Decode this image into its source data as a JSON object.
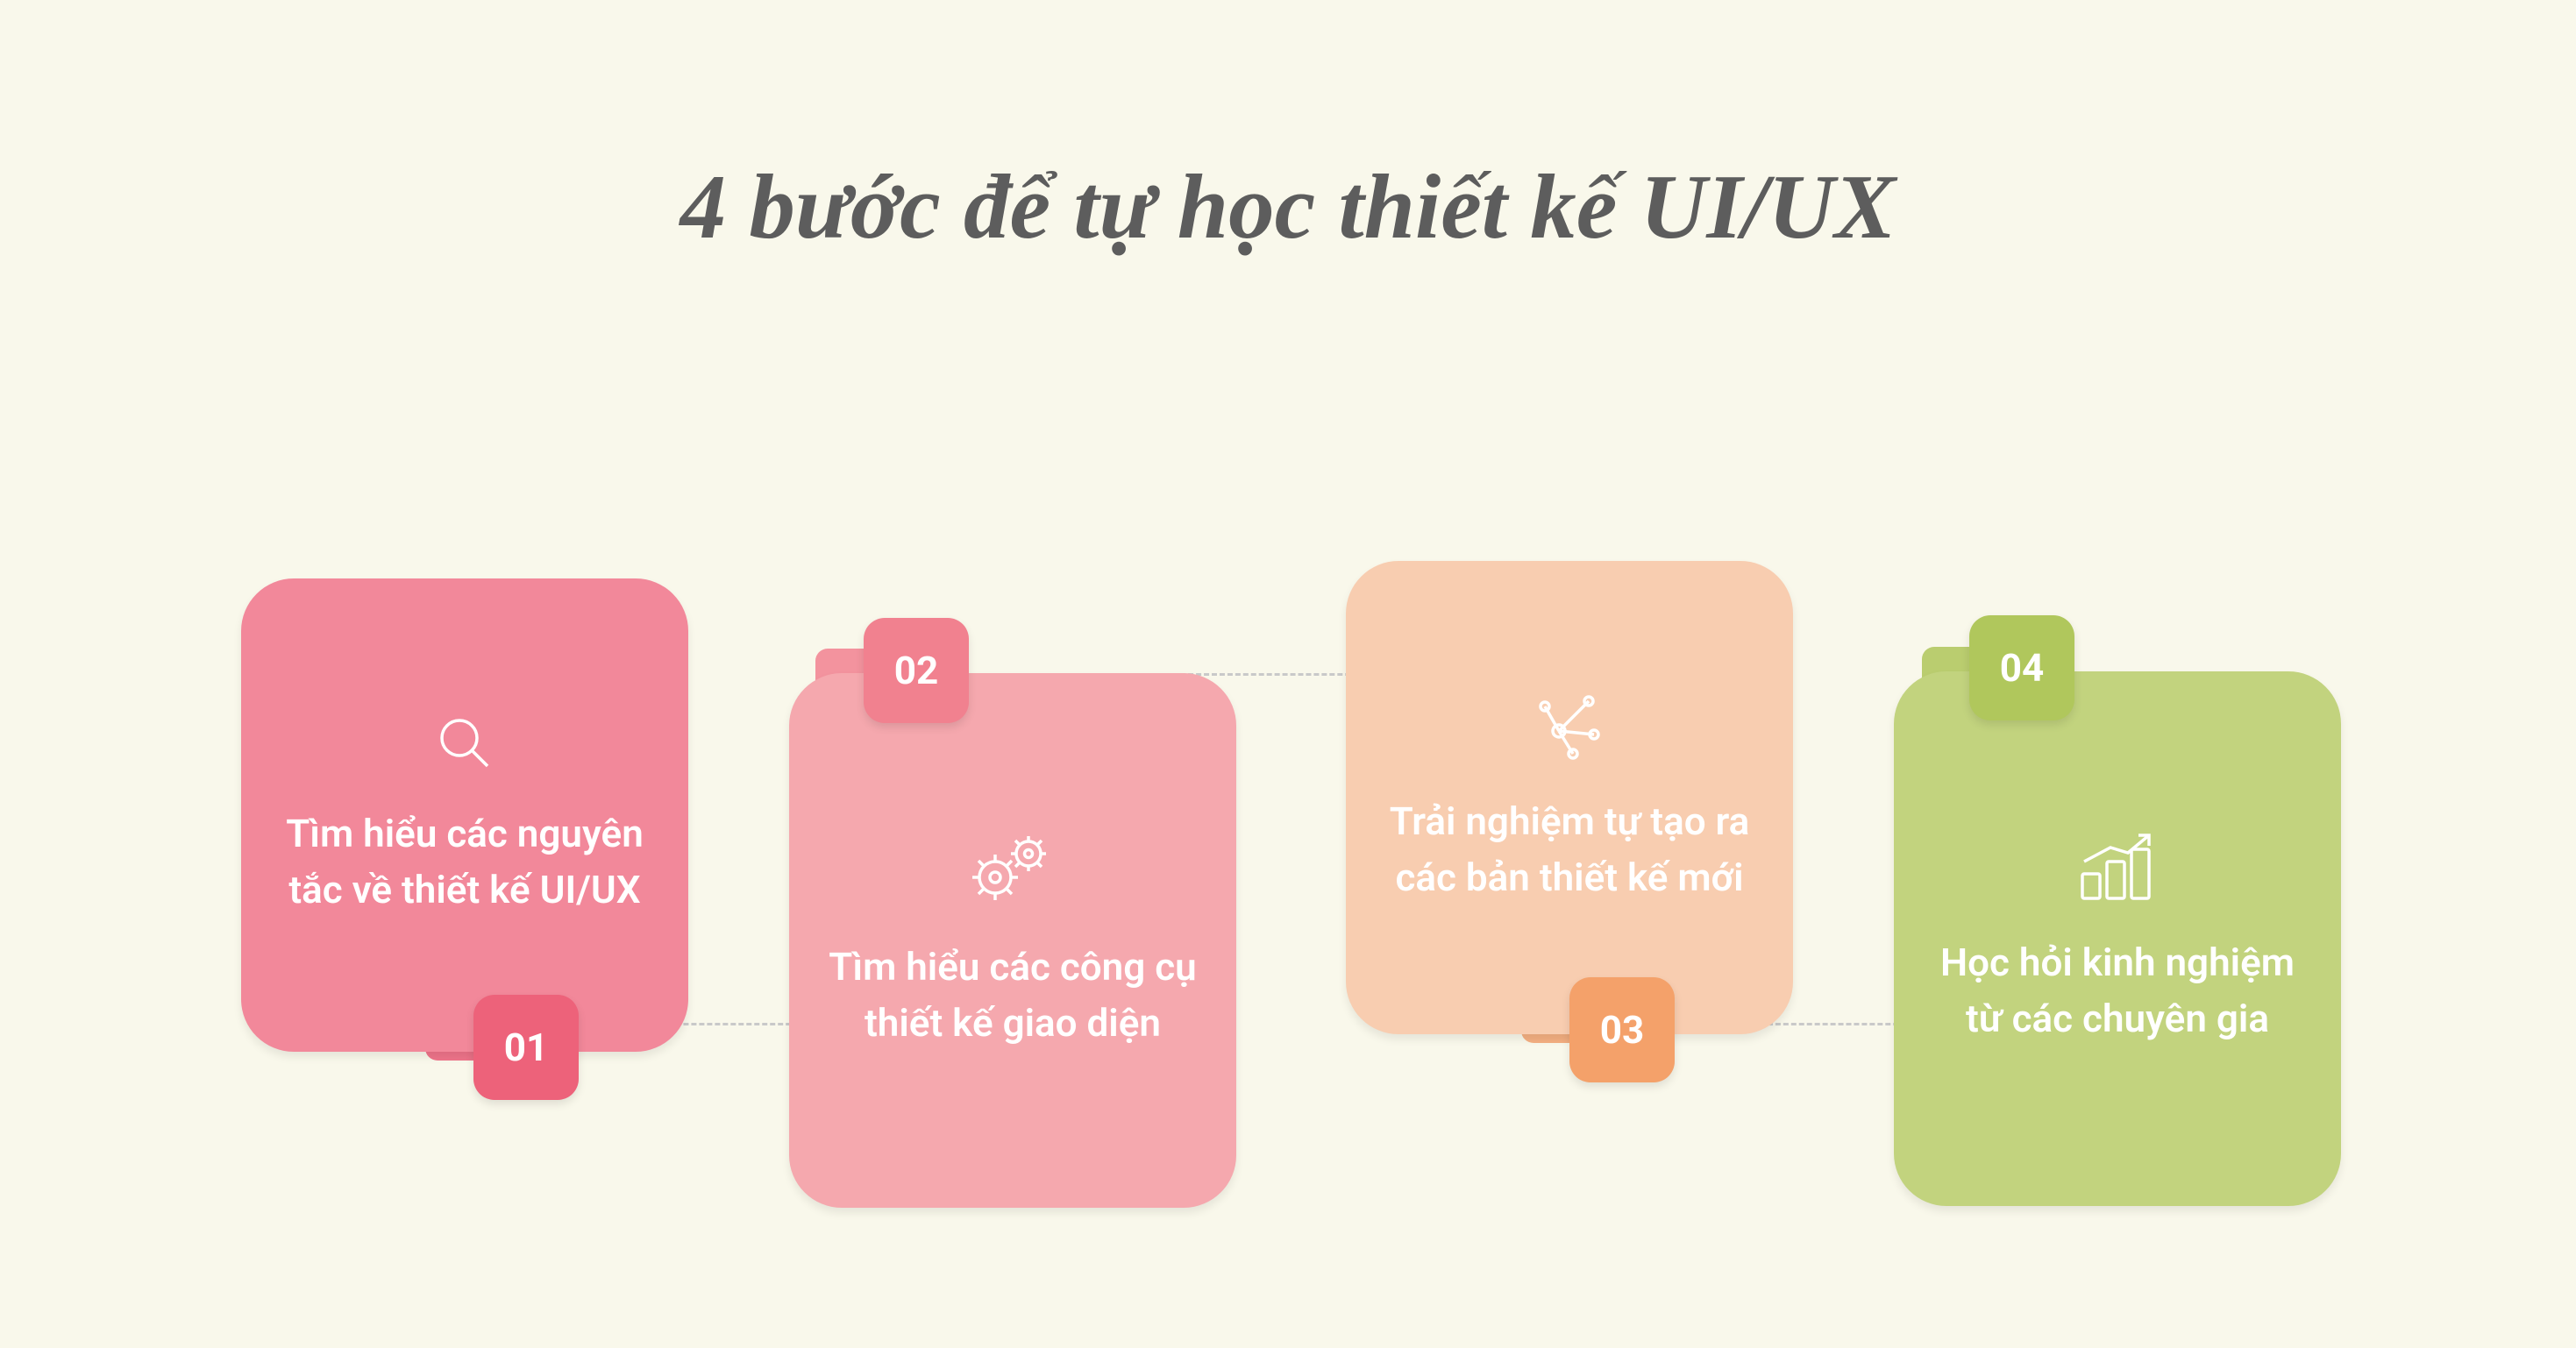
{
  "title": "4 bước để tự học thiết kế UI/UX",
  "steps": [
    {
      "num": "01",
      "text": "Tìm hiểu các nguyên tắc về thiết kế UI/UX"
    },
    {
      "num": "02",
      "text": "Tìm hiểu các công cụ thiết kế giao diện"
    },
    {
      "num": "03",
      "text": "Trải nghiệm tự tạo ra các bản thiết kế mới"
    },
    {
      "num": "04",
      "text": "Học hỏi kinh nghiệm từ các chuyên gia"
    }
  ],
  "colors": {
    "background": "#f9f8eb",
    "title": "#5d5d5d",
    "cards": [
      "#f2889a",
      "#f5a8ae",
      "#f8cdb0",
      "#c2d37e"
    ],
    "badges": [
      "#ed627a",
      "#f1818f",
      "#f4a16a",
      "#b0c75c"
    ]
  }
}
